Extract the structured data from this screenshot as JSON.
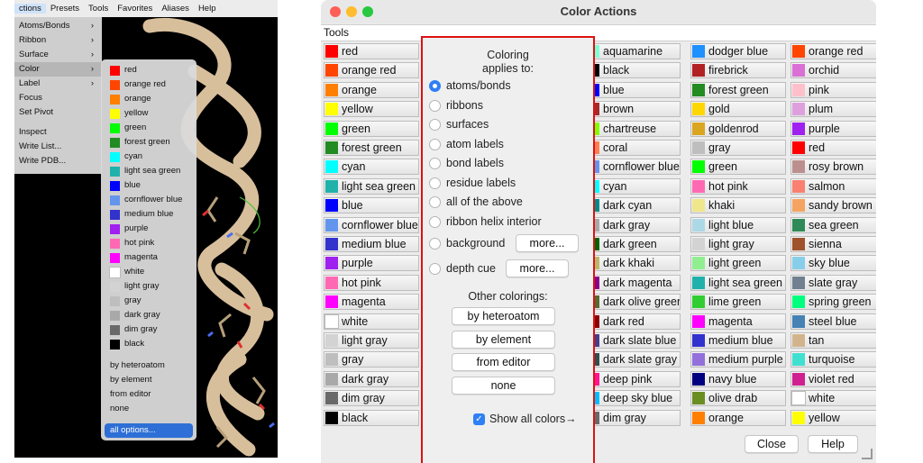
{
  "left_app": {
    "menubar": [
      "ctions",
      "Presets",
      "Tools",
      "Favorites",
      "Aliases",
      "Help"
    ],
    "actions_menu": [
      "Atoms/Bonds",
      "Ribbon",
      "Surface",
      "Color",
      "Label",
      "Focus",
      "Set Pivot",
      "Inspect",
      "Write List...",
      "Write PDB..."
    ],
    "submenu_arrow": "›",
    "color_submenu": [
      {
        "label": "red",
        "color": "#ff0000"
      },
      {
        "label": "orange red",
        "color": "#ff4500"
      },
      {
        "label": "orange",
        "color": "#ff7f00"
      },
      {
        "label": "yellow",
        "color": "#ffff00"
      },
      {
        "label": "green",
        "color": "#00ff00"
      },
      {
        "label": "forest green",
        "color": "#228b22"
      },
      {
        "label": "cyan",
        "color": "#00ffff"
      },
      {
        "label": "light sea green",
        "color": "#20b2aa"
      },
      {
        "label": "blue",
        "color": "#0000ff"
      },
      {
        "label": "cornflower blue",
        "color": "#6495ed"
      },
      {
        "label": "medium blue",
        "color": "#3232cd"
      },
      {
        "label": "purple",
        "color": "#a020f0"
      },
      {
        "label": "hot pink",
        "color": "#ff69b4"
      },
      {
        "label": "magenta",
        "color": "#ff00ff"
      },
      {
        "label": "white",
        "color": "#ffffff"
      },
      {
        "label": "light gray",
        "color": "#d3d3d3"
      },
      {
        "label": "gray",
        "color": "#bebebe"
      },
      {
        "label": "dark gray",
        "color": "#a9a9a9"
      },
      {
        "label": "dim gray",
        "color": "#696969"
      },
      {
        "label": "black",
        "color": "#000000"
      }
    ],
    "color_submenu_extra": [
      "by heteroatom",
      "by element",
      "from editor",
      "none"
    ],
    "color_submenu_all": "all options..."
  },
  "window": {
    "title": "Color Actions",
    "tools_label": "Tools",
    "coloring_title": "Coloring\napplies to:",
    "targets": [
      "atoms/bonds",
      "ribbons",
      "surfaces",
      "atom labels",
      "bond labels",
      "residue labels",
      "all of the above",
      "ribbon helix interior"
    ],
    "selected_target": "atoms/bonds",
    "background_label": "background",
    "depth_cue_label": "depth cue",
    "more_label": "more...",
    "other_title": "Other colorings:",
    "other_buttons": [
      "by heteroatom",
      "by element",
      "from editor",
      "none"
    ],
    "show_all_label": "Show all colors→",
    "show_all_checked": true,
    "close_label": "Close",
    "help_label": "Help",
    "col0": [
      {
        "name": "red",
        "color": "#ff0000"
      },
      {
        "name": "orange red",
        "color": "#ff4500"
      },
      {
        "name": "orange",
        "color": "#ff7f00"
      },
      {
        "name": "yellow",
        "color": "#ffff00"
      },
      {
        "name": "green",
        "color": "#00ff00"
      },
      {
        "name": "forest green",
        "color": "#228b22"
      },
      {
        "name": "cyan",
        "color": "#00ffff"
      },
      {
        "name": "light sea green",
        "color": "#20b2aa"
      },
      {
        "name": "blue",
        "color": "#0000ff"
      },
      {
        "name": "cornflower blue",
        "color": "#6495ed"
      },
      {
        "name": "medium blue",
        "color": "#3232cd"
      },
      {
        "name": "purple",
        "color": "#a020f0"
      },
      {
        "name": "hot pink",
        "color": "#ff69b4"
      },
      {
        "name": "magenta",
        "color": "#ff00ff"
      },
      {
        "name": "white",
        "color": "#ffffff"
      },
      {
        "name": "light gray",
        "color": "#d3d3d3"
      },
      {
        "name": "gray",
        "color": "#bebebe"
      },
      {
        "name": "dark gray",
        "color": "#a9a9a9"
      },
      {
        "name": "dim gray",
        "color": "#696969"
      },
      {
        "name": "black",
        "color": "#000000"
      }
    ],
    "hidden_col": [
      "#7fffd4",
      "#000000",
      "#0000ff",
      "#a52a2a",
      "#7fff00",
      "#ff7f50",
      "#6495ed",
      "#00ffff",
      "#008b8b",
      "#a9a9a9",
      "#006400",
      "#bdb76b",
      "#8b008b",
      "#556b2f",
      "#8b0000",
      "#483d8b",
      "#2f4f4f",
      "#ff1493",
      "#00bfff",
      "#696969"
    ],
    "col2": [
      {
        "name": "aquamarine",
        "color": "#7fffd4"
      },
      {
        "name": "black",
        "color": "#000000"
      },
      {
        "name": "blue",
        "color": "#0000ff"
      },
      {
        "name": "brown",
        "color": "#a52a2a"
      },
      {
        "name": "chartreuse",
        "color": "#7fff00"
      },
      {
        "name": "coral",
        "color": "#ff7f50"
      },
      {
        "name": "cornflower blue",
        "color": "#6495ed"
      },
      {
        "name": "cyan",
        "color": "#00ffff"
      },
      {
        "name": "dark cyan",
        "color": "#008b8b"
      },
      {
        "name": "dark gray",
        "color": "#a9a9a9"
      },
      {
        "name": "dark green",
        "color": "#006400"
      },
      {
        "name": "dark khaki",
        "color": "#bdb76b"
      },
      {
        "name": "dark magenta",
        "color": "#8b008b"
      },
      {
        "name": "dark olive green",
        "color": "#556b2f"
      },
      {
        "name": "dark red",
        "color": "#8b0000"
      },
      {
        "name": "dark slate blue",
        "color": "#483d8b"
      },
      {
        "name": "dark slate gray",
        "color": "#2f4f4f"
      },
      {
        "name": "deep pink",
        "color": "#ff1493"
      },
      {
        "name": "deep sky blue",
        "color": "#00bfff"
      },
      {
        "name": "dim gray",
        "color": "#696969"
      }
    ],
    "col3": [
      {
        "name": "dodger blue",
        "color": "#1e90ff"
      },
      {
        "name": "firebrick",
        "color": "#b22222"
      },
      {
        "name": "forest green",
        "color": "#228b22"
      },
      {
        "name": "gold",
        "color": "#ffd700"
      },
      {
        "name": "goldenrod",
        "color": "#daa520"
      },
      {
        "name": "gray",
        "color": "#bebebe"
      },
      {
        "name": "green",
        "color": "#00ff00"
      },
      {
        "name": "hot pink",
        "color": "#ff69b4"
      },
      {
        "name": "khaki",
        "color": "#f0e68c"
      },
      {
        "name": "light blue",
        "color": "#add8e6"
      },
      {
        "name": "light gray",
        "color": "#d3d3d3"
      },
      {
        "name": "light green",
        "color": "#90ee90"
      },
      {
        "name": "light sea green",
        "color": "#20b2aa"
      },
      {
        "name": "lime green",
        "color": "#32cd32"
      },
      {
        "name": "magenta",
        "color": "#ff00ff"
      },
      {
        "name": "medium blue",
        "color": "#3232cd"
      },
      {
        "name": "medium purple",
        "color": "#9370db"
      },
      {
        "name": "navy blue",
        "color": "#000080"
      },
      {
        "name": "olive drab",
        "color": "#6b8e23"
      },
      {
        "name": "orange",
        "color": "#ff7f00"
      }
    ],
    "col4": [
      {
        "name": "orange red",
        "color": "#ff4500"
      },
      {
        "name": "orchid",
        "color": "#da70d6"
      },
      {
        "name": "pink",
        "color": "#ffc0cb"
      },
      {
        "name": "plum",
        "color": "#dda0dd"
      },
      {
        "name": "purple",
        "color": "#a020f0"
      },
      {
        "name": "red",
        "color": "#ff0000"
      },
      {
        "name": "rosy brown",
        "color": "#bc8f8f"
      },
      {
        "name": "salmon",
        "color": "#fa8072"
      },
      {
        "name": "sandy brown",
        "color": "#f4a460"
      },
      {
        "name": "sea green",
        "color": "#2e8b57"
      },
      {
        "name": "sienna",
        "color": "#a0522d"
      },
      {
        "name": "sky blue",
        "color": "#87ceeb"
      },
      {
        "name": "slate gray",
        "color": "#708090"
      },
      {
        "name": "spring green",
        "color": "#00ff7f"
      },
      {
        "name": "steel blue",
        "color": "#4682b4"
      },
      {
        "name": "tan",
        "color": "#d2b48c"
      },
      {
        "name": "turquoise",
        "color": "#40e0d0"
      },
      {
        "name": "violet red",
        "color": "#d02090"
      },
      {
        "name": "white",
        "color": "#ffffff"
      },
      {
        "name": "yellow",
        "color": "#ffff00"
      }
    ]
  }
}
